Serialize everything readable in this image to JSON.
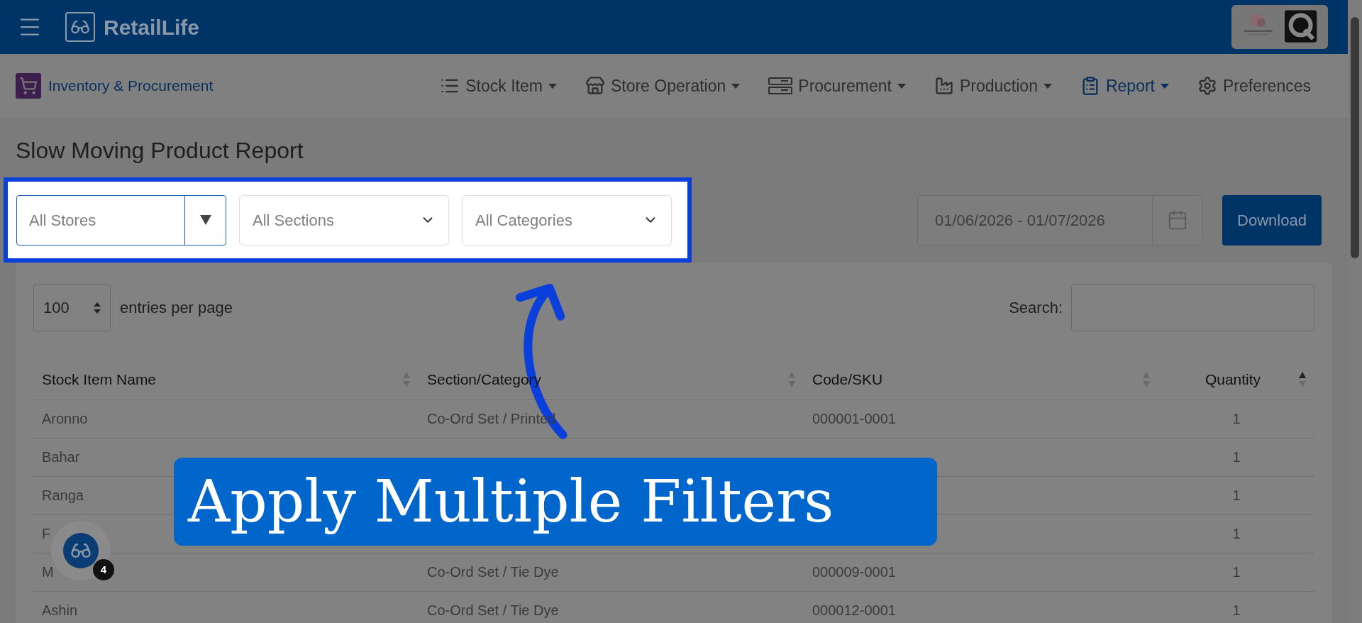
{
  "header": {
    "brand": "RetailLife"
  },
  "nav": {
    "module": "Inventory & Procurement",
    "items": [
      {
        "label": "Stock Item",
        "has_caret": true,
        "selected": false
      },
      {
        "label": "Store Operation",
        "has_caret": true,
        "selected": false
      },
      {
        "label": "Procurement",
        "has_caret": true,
        "selected": false
      },
      {
        "label": "Production",
        "has_caret": true,
        "selected": false
      },
      {
        "label": "Report",
        "has_caret": true,
        "selected": true
      },
      {
        "label": "Preferences",
        "has_caret": false,
        "selected": false
      }
    ]
  },
  "page_title": "Slow Moving Product Report",
  "filters": [
    {
      "placeholder": "All Stores",
      "kind": "split"
    },
    {
      "placeholder": "All Sections",
      "kind": "chevron"
    },
    {
      "placeholder": "All Categories",
      "kind": "chevron"
    }
  ],
  "date_range": {
    "value": "01/06/2026 - 01/07/2026"
  },
  "download_button": "Download",
  "entries": {
    "value": "100",
    "label": "entries per page"
  },
  "search": {
    "label": "Search:"
  },
  "table": {
    "columns": [
      {
        "label": "Stock Item Name",
        "sorted_ascending": false
      },
      {
        "label": "Section/Category",
        "sorted_ascending": false
      },
      {
        "label": "Code/SKU",
        "sorted_ascending": false
      },
      {
        "label": "Quantity",
        "sorted_ascending": true
      }
    ],
    "rows": [
      [
        "Aronno",
        "Co-Ord Set / Printed",
        "000001-0001",
        "1"
      ],
      [
        "Bahar",
        "",
        "",
        "1"
      ],
      [
        "Ranga",
        "",
        "",
        "1"
      ],
      [
        "F",
        "",
        "",
        "1"
      ],
      [
        "M",
        "Co-Ord Set / Tie Dye",
        "000009-0001",
        "1"
      ],
      [
        "Ashin",
        "Co-Ord Set / Tie Dye",
        "000012-0001",
        "1"
      ]
    ]
  },
  "callout": "Apply Multiple Filters",
  "help_badge": "4"
}
